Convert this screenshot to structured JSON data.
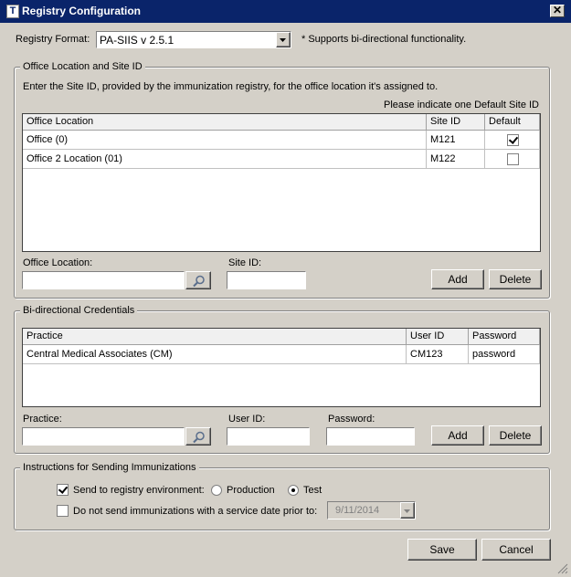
{
  "window": {
    "title": "Registry Configuration",
    "close_glyph": "✕"
  },
  "format": {
    "label": "Registry Format:",
    "value": "PA-SIIS v 2.5.1",
    "note": "* Supports bi-directional functionality."
  },
  "office": {
    "legend": "Office Location and Site ID",
    "instruction": "Enter the Site ID, provided by the immunization registry, for the office location it's assigned to.",
    "default_hint": "Please indicate one Default Site ID",
    "columns": [
      "Office Location",
      "Site ID",
      "Default"
    ],
    "rows": [
      {
        "location": "Office (0)",
        "site_id": "M121",
        "default": true
      },
      {
        "location": "Office 2 Location (01)",
        "site_id": "M122",
        "default": false
      }
    ],
    "location_label": "Office Location:",
    "location_value": "",
    "siteid_label": "Site ID:",
    "siteid_value": "",
    "add_label": "Add",
    "delete_label": "Delete"
  },
  "credentials": {
    "legend": "Bi-directional Credentials",
    "columns": [
      "Practice",
      "User ID",
      "Password"
    ],
    "rows": [
      {
        "practice": "Central Medical Associates (CM)",
        "user_id": "CM123",
        "password": "password"
      }
    ],
    "practice_label": "Practice:",
    "practice_value": "",
    "userid_label": "User ID:",
    "userid_value": "",
    "password_label": "Password:",
    "password_value": "",
    "add_label": "Add",
    "delete_label": "Delete"
  },
  "instructions": {
    "legend": "Instructions for Sending Immunizations",
    "send_label": "Send to registry environment:",
    "send_checked": true,
    "production_label": "Production",
    "test_label": "Test",
    "selected_env": "Test",
    "nosend_label": "Do not send immunizations with a service date prior to:",
    "nosend_checked": false,
    "date_value": "9/11/2014"
  },
  "footer": {
    "save_label": "Save",
    "cancel_label": "Cancel"
  },
  "icons": {
    "lookup": "magnifier-icon",
    "app": "app-icon",
    "dropdown": "chevron-down-icon"
  }
}
